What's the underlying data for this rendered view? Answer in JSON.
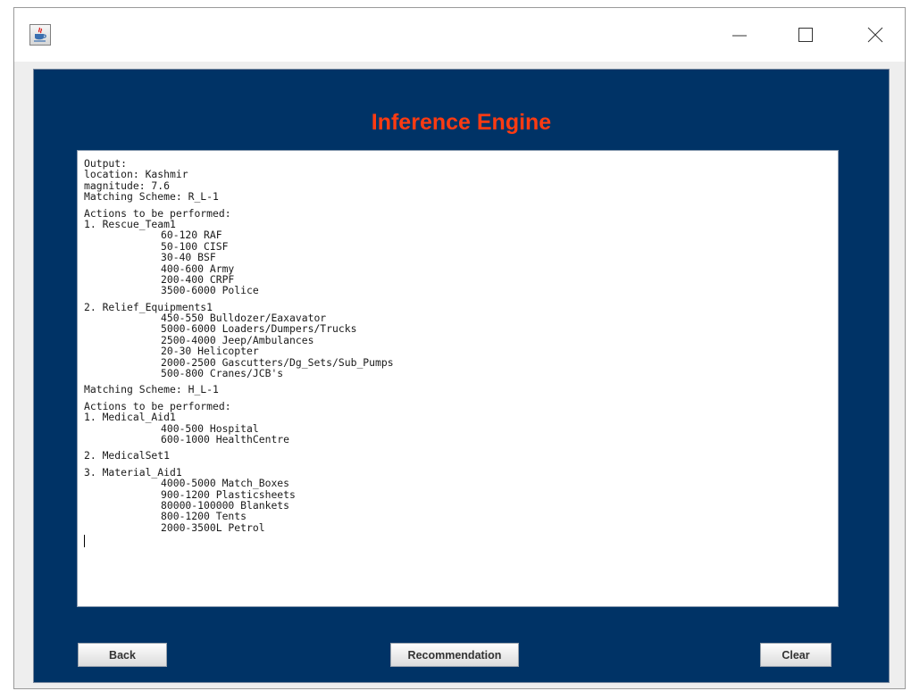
{
  "window": {
    "app_icon": "java-coffee-cup-icon",
    "controls": [
      "minimize-icon",
      "maximize-icon",
      "close-icon"
    ]
  },
  "heading": "Inference Engine",
  "output": {
    "header": [
      "Output:",
      "location: Kashmir",
      "magnitude: 7.6",
      "Matching Scheme: R_L-1"
    ],
    "block1_title": "Actions to be performed:",
    "rescue_title": "1. Rescue_Team1",
    "rescue_items": [
      "60-120 RAF",
      "50-100 CISF",
      "30-40 BSF",
      "400-600 Army",
      "200-400 CRPF",
      "3500-6000 Police"
    ],
    "relief_title": "2. Relief_Equipments1",
    "relief_items": [
      "450-550 Bulldozer/Eaxavator",
      "5000-6000 Loaders/Dumpers/Trucks",
      "2500-4000 Jeep/Ambulances",
      "20-30 Helicopter",
      "2000-2500 Gascutters/Dg_Sets/Sub_Pumps",
      "500-800 Cranes/JCB's"
    ],
    "scheme2": "Matching Scheme: H_L-1",
    "block2_title": "Actions to be performed:",
    "medical_title": "1. Medical_Aid1",
    "medical_items": [
      "400-500 Hospital",
      "600-1000 HealthCentre"
    ],
    "medicalset_title": "2. MedicalSet1",
    "material_title": "3. Material_Aid1",
    "material_items": [
      "4000-5000 Match_Boxes",
      "900-1200 Plasticsheets",
      "80000-100000 Blankets",
      "800-1200 Tents",
      "2000-3500L Petrol"
    ]
  },
  "buttons": {
    "back": "Back",
    "recommendation": "Recommendation",
    "clear": "Clear"
  },
  "colors": {
    "panel_background": "#003366",
    "heading": "#ff3b12"
  }
}
